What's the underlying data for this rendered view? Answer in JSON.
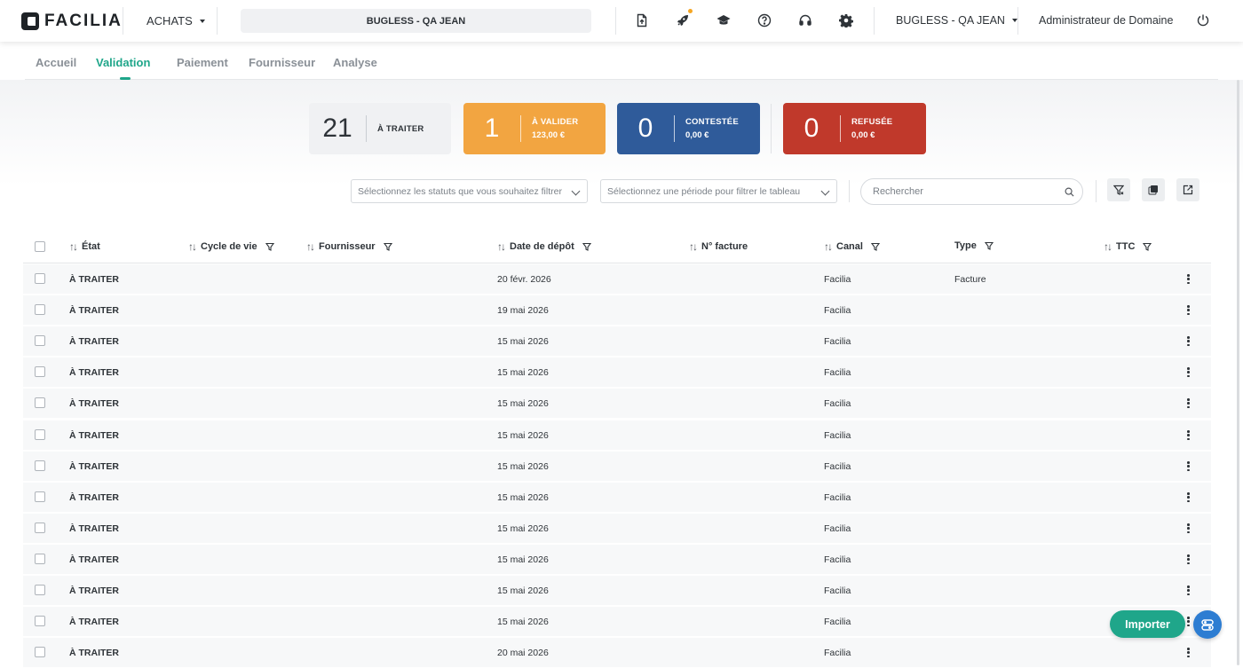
{
  "app": {
    "logo_text": "FACILIA"
  },
  "header": {
    "module_menu": "ACHATS",
    "company_display": "BUGLESS - QA JEAN",
    "company_selector": "BUGLESS - QA JEAN",
    "user_name": "Administrateur de Domaine",
    "icons": [
      "document-upload-icon",
      "rocket-icon",
      "graduation-cap-icon",
      "help-icon",
      "headset-icon",
      "gear-icon",
      "power-icon"
    ]
  },
  "tabs": [
    {
      "label": "Accueil",
      "active": false
    },
    {
      "label": "Validation",
      "active": true
    },
    {
      "label": "Paiement",
      "active": false
    },
    {
      "label": "Fournisseur",
      "active": false
    },
    {
      "label": "Analyse",
      "active": false
    }
  ],
  "kpis": {
    "traiter": {
      "count": "21",
      "label": "À TRAITER"
    },
    "valider": {
      "count": "1",
      "label": "À VALIDER",
      "amount": "123,00 €"
    },
    "contestee": {
      "count": "0",
      "label": "CONTESTÉE",
      "amount": "0,00 €"
    },
    "refusee": {
      "count": "0",
      "label": "REFUSÉE",
      "amount": "0,00 €"
    }
  },
  "filters": {
    "status_placeholder": "Sélectionnez les statuts que vous souhaitez filtrer",
    "period_placeholder": "Sélectionnez une période pour filtrer le tableau",
    "search_placeholder": "Rechercher"
  },
  "table": {
    "headers": {
      "etat": "État",
      "cycle": "Cycle de vie",
      "fournisseur": "Fournisseur",
      "date": "Date de dépôt",
      "facture": "N° facture",
      "canal": "Canal",
      "type": "Type",
      "ttc": "TTC"
    },
    "rows": [
      {
        "etat": "À TRAITER",
        "date": "20 févr. 2026",
        "canal": "Facilia",
        "type": "Facture"
      },
      {
        "etat": "À TRAITER",
        "date": "19 mai 2026",
        "canal": "Facilia",
        "type": ""
      },
      {
        "etat": "À TRAITER",
        "date": "15 mai 2026",
        "canal": "Facilia",
        "type": ""
      },
      {
        "etat": "À TRAITER",
        "date": "15 mai 2026",
        "canal": "Facilia",
        "type": ""
      },
      {
        "etat": "À TRAITER",
        "date": "15 mai 2026",
        "canal": "Facilia",
        "type": ""
      },
      {
        "etat": "À TRAITER",
        "date": "15 mai 2026",
        "canal": "Facilia",
        "type": ""
      },
      {
        "etat": "À TRAITER",
        "date": "15 mai 2026",
        "canal": "Facilia",
        "type": ""
      },
      {
        "etat": "À TRAITER",
        "date": "15 mai 2026",
        "canal": "Facilia",
        "type": ""
      },
      {
        "etat": "À TRAITER",
        "date": "15 mai 2026",
        "canal": "Facilia",
        "type": ""
      },
      {
        "etat": "À TRAITER",
        "date": "15 mai 2026",
        "canal": "Facilia",
        "type": ""
      },
      {
        "etat": "À TRAITER",
        "date": "15 mai 2026",
        "canal": "Facilia",
        "type": ""
      },
      {
        "etat": "À TRAITER",
        "date": "15 mai 2026",
        "canal": "Facilia",
        "type": ""
      },
      {
        "etat": "À TRAITER",
        "date": "20 mai 2026",
        "canal": "Facilia",
        "type": ""
      }
    ]
  },
  "actions": {
    "import_label": "Importer"
  },
  "colors": {
    "accent": "#1fa68a",
    "valider": "#f2a541",
    "contestee": "#2f5b9a",
    "refusee": "#c0392b",
    "chat": "#2d7dd2"
  }
}
